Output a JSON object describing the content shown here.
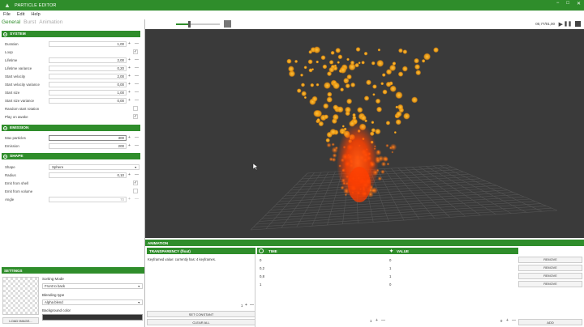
{
  "window": {
    "title": "PARTICLE EDITOR",
    "controls": [
      "−",
      "□",
      "✕"
    ]
  },
  "menu": [
    "File",
    "Edit",
    "Help"
  ],
  "tabs": [
    "General",
    "Burst",
    "Animation"
  ],
  "system": {
    "header": "SYSTEM",
    "rows": [
      {
        "label": "Duration",
        "value": "1,00"
      },
      {
        "label": "Loop",
        "checked": "✓"
      },
      {
        "label": "Lifetime",
        "value": "2,00"
      },
      {
        "label": "Lifetime variance",
        "value": "0,20"
      },
      {
        "label": "Start velocity",
        "value": "2,00"
      },
      {
        "label": "Start velocity variance",
        "value": "0,00"
      },
      {
        "label": "Start size",
        "value": "1,00"
      },
      {
        "label": "Start size variance",
        "value": "0,00"
      },
      {
        "label": "Random start rotation",
        "checked": ""
      },
      {
        "label": "Play on awake",
        "checked": "✓"
      }
    ]
  },
  "emission": {
    "header": "EMISSION",
    "rows": [
      {
        "label": "Max particles",
        "value": "300"
      },
      {
        "label": "Emission",
        "value": "200"
      }
    ]
  },
  "shape": {
    "header": "SHAPE",
    "shape_label": "Shape",
    "shape_value": "Sphere",
    "radius_label": "Radius",
    "radius_value": "0,10",
    "emit_shell_label": "Emit from shell",
    "emit_shell": "✓",
    "emit_volume_label": "Emit from volume",
    "emit_volume": "",
    "angle_label": "Angle",
    "angle_value": "70"
  },
  "settings": {
    "header": "SETTINGS",
    "sorting_label": "Sorting Mode",
    "sorting_value": "Front to back",
    "blending_label": "Blending type",
    "blending_value": "Alpha blend",
    "bg_label": "Background color",
    "load_image": "LOAD IMAGE..."
  },
  "viewport": {
    "time": "00,77/01,00",
    "zoom_level": 0.3
  },
  "animation": {
    "header": "ANIMATION",
    "property": "TRANSPARENCY (float)",
    "message": "Keyframed value: currently has: 4 keyframes.",
    "time_header": "TIME",
    "value_header": "VALUE",
    "keyframes": [
      {
        "time": "0",
        "value": "0"
      },
      {
        "time": "0,2",
        "value": "1"
      },
      {
        "time": "0,8",
        "value": "1"
      },
      {
        "time": "1",
        "value": "0"
      }
    ],
    "remove_label": "REMOVE",
    "set_constant": "SET CONSTANT",
    "clear_all": "CLEAR ALL",
    "add": "ADD",
    "counters": [
      "1",
      "1",
      "0"
    ]
  },
  "colors": {
    "accent": "#2f8d2b",
    "viewport": "#3a3a3a"
  }
}
